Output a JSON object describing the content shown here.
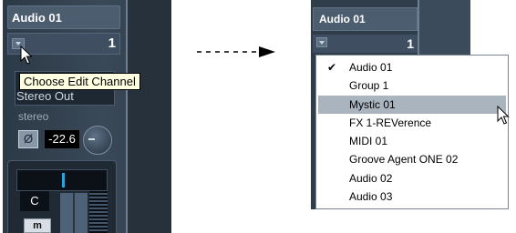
{
  "left": {
    "channel_name": "Audio 01",
    "channel_number": "1",
    "tooltip": "Choose Edit Channel",
    "output": "Stereo Out",
    "config": "stereo",
    "phase_symbol": "Ø",
    "input_gain": "-22.6",
    "pan": "C",
    "mute": "m"
  },
  "right": {
    "channel_name": "Audio 01",
    "channel_number": "1",
    "menu": {
      "items": [
        {
          "label": "Audio 01",
          "checked": true
        },
        {
          "label": "Group 1"
        },
        {
          "label": "Mystic 01",
          "highlighted": true
        },
        {
          "label": "FX 1-REVerence"
        },
        {
          "label": "MIDI 01"
        },
        {
          "label": "Groove Agent ONE 02"
        },
        {
          "label": "Audio 02"
        },
        {
          "label": "Audio 03"
        }
      ]
    }
  },
  "colors": {
    "panel": "#3a4958",
    "header": "#4c5d70",
    "tooltip_bg": "#ffffe1",
    "menu_highlight": "#a9b4bf"
  }
}
